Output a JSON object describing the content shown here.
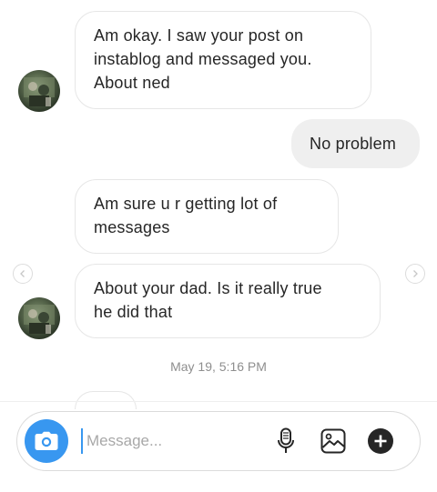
{
  "thread": {
    "messages": [
      {
        "direction": "incoming",
        "text": "Am okay. I saw your post on\ninstablog and messaged you.\nAbout ned"
      },
      {
        "direction": "outgoing",
        "text": "No problem"
      },
      {
        "direction": "incoming",
        "text": "Am sure u r getting lot of\nmessages"
      },
      {
        "direction": "incoming",
        "text": "About your dad. Is it really true\nhe did that"
      }
    ],
    "timestamp": "May 19, 5:16 PM"
  },
  "composer": {
    "placeholder": "Message...",
    "icons": [
      "camera-icon",
      "microphone-icon",
      "gallery-icon",
      "plus-icon"
    ]
  },
  "colors": {
    "accent": "#3897f0",
    "incoming_border": "#e6e6e6",
    "outgoing_bg": "#efefef",
    "timestamp": "#8e8e8e"
  }
}
